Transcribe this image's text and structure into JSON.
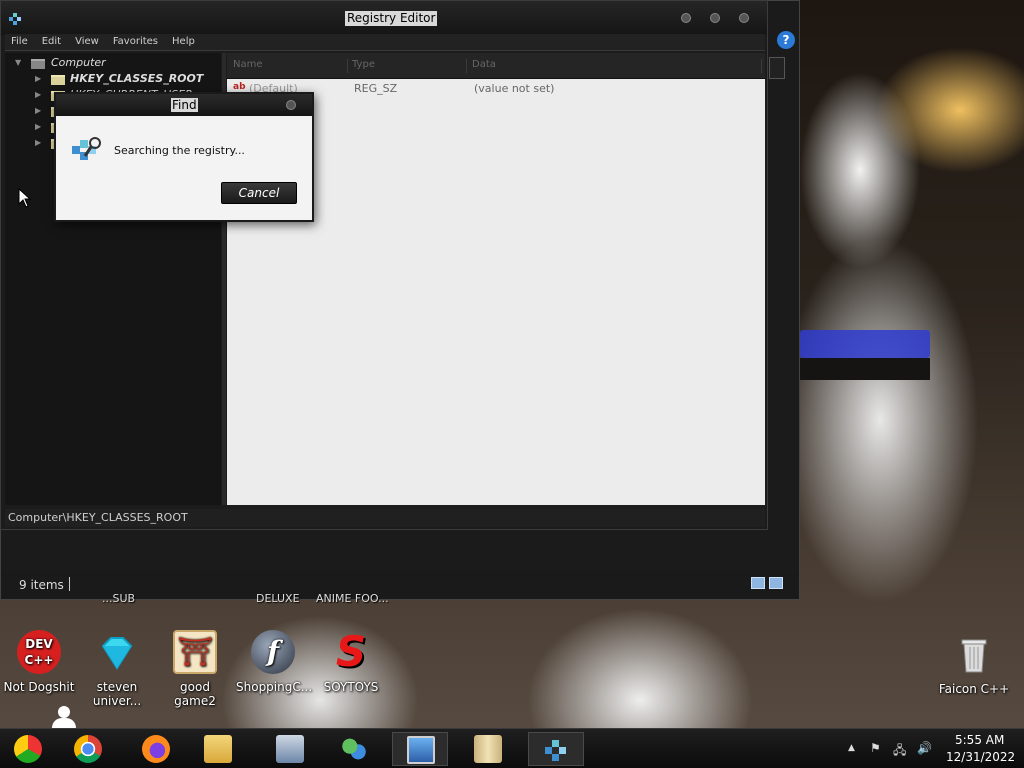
{
  "registry_editor": {
    "title": "Registry Editor",
    "menu": [
      "File",
      "Edit",
      "View",
      "Favorites",
      "Help"
    ],
    "tree": {
      "root": "Computer",
      "items": [
        "HKEY_CLASSES_ROOT",
        "HKEY_CURRENT_USER"
      ]
    },
    "list": {
      "columns": [
        "Name",
        "Type",
        "Data"
      ],
      "rows": [
        {
          "name": "(Default)",
          "type": "REG_SZ",
          "data": "(value not set)"
        }
      ]
    },
    "status_path": "Computer\\HKEY_CLASSES_ROOT"
  },
  "find_dialog": {
    "title": "Find",
    "message": "Searching the registry...",
    "cancel_label": "Cancel"
  },
  "explorer": {
    "status_count": "9 items",
    "help_label": "?"
  },
  "desktop": {
    "partial_labels": [
      "...SUB",
      "DELUXE",
      "ANIME FOO..."
    ],
    "icons": [
      {
        "label": "Not Dogshit",
        "icon": "dev-cpp-icon",
        "badge_line1": "DEV",
        "badge_line2": "C++"
      },
      {
        "label": "steven univer...",
        "icon": "diamond-icon"
      },
      {
        "label": "good game2",
        "icon": "torii-gate-icon"
      },
      {
        "label": "ShoppingC...",
        "icon": "flash-player-icon"
      },
      {
        "label": "SOYTOYS",
        "icon": "s-logo-icon"
      },
      {
        "label": "Faicon C++",
        "icon": "recycle-bin-icon"
      }
    ]
  },
  "taskbar": {
    "time": "5:55 AM",
    "date": "12/31/2022",
    "apps": [
      "chrome-alt-icon",
      "chrome-icon",
      "firefox-icon",
      "file-explorer-icon",
      "keyboard-computer-icon",
      "network-people-icon",
      "photo-viewer-icon",
      "scroll-notes-icon",
      "registry-editor-icon"
    ]
  },
  "colors": {
    "window_dark": "#1c1c1c",
    "list_bg": "#ececec",
    "help_blue": "#2a7ad6",
    "stripe_blue": "#2f3cd0"
  }
}
